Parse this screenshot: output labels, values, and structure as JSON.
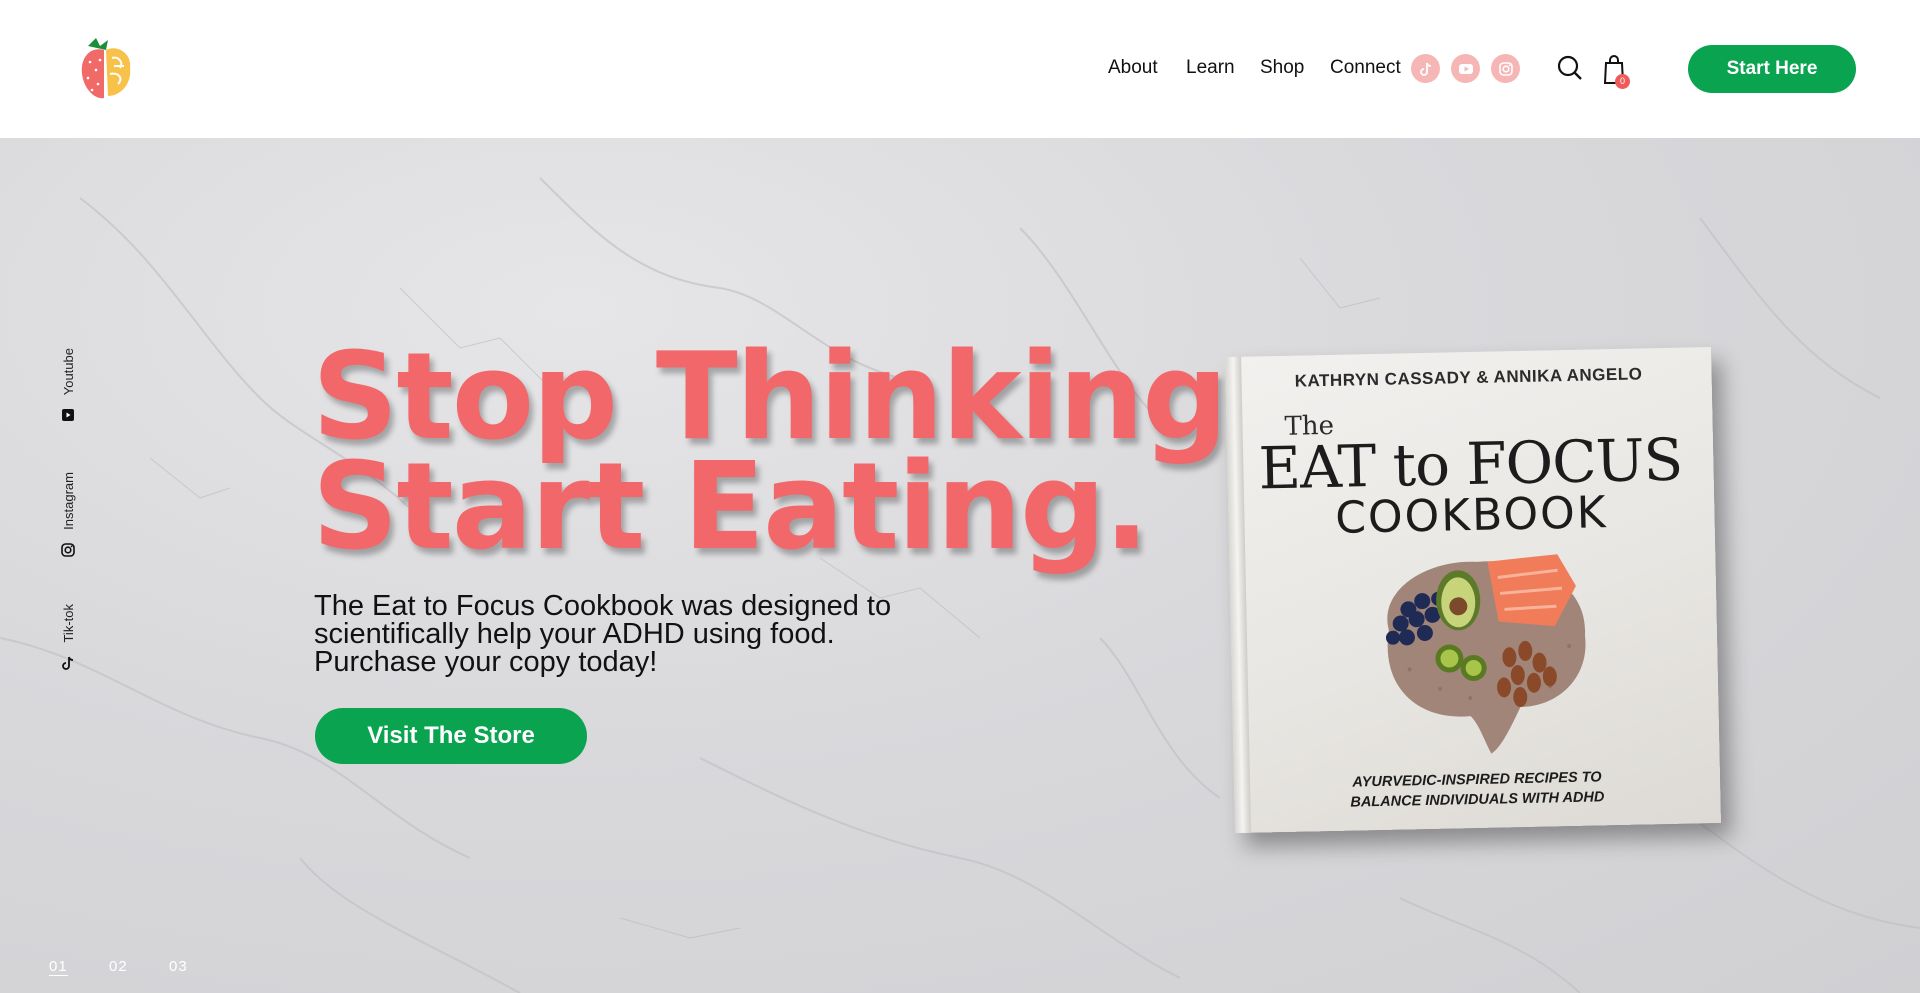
{
  "header": {
    "logo_name": "strawberry-brain-logo",
    "nav": [
      {
        "label": "About"
      },
      {
        "label": "Learn"
      },
      {
        "label": "Shop"
      },
      {
        "label": "Connect"
      }
    ],
    "social_icons": [
      "tiktok-icon",
      "youtube-icon",
      "instagram-icon"
    ],
    "cart_count": "0",
    "start_label": "Start Here"
  },
  "hero": {
    "headline_line1": "Stop Thinking.",
    "headline_line2": "Start Eating.",
    "subtext": "The Eat to Focus Cookbook was designed to scientifically help your ADHD using food. Purchase your copy today!",
    "button_label": "Visit The Store",
    "side_social": [
      {
        "label": "Youtube",
        "icon": "youtube-icon"
      },
      {
        "label": "Instagram",
        "icon": "instagram-icon"
      },
      {
        "label": "Tik-tok",
        "icon": "tiktok-icon"
      }
    ],
    "pager": [
      "01",
      "02",
      "03"
    ],
    "pager_active": "01"
  },
  "book": {
    "authors": "KATHRYN CASSADY & ANNIKA ANGELO",
    "the": "The",
    "title": "EAT to FOCUS",
    "subtitle": "COOKBOOK",
    "tagline_line1": "AYURVEDIC-INSPIRED RECIPES TO",
    "tagline_line2": "BALANCE INDIVIDUALS WITH ADHD"
  },
  "colors": {
    "accent_green": "#0aa350",
    "headline_coral": "#f2686a",
    "social_pink": "#f6b6b6"
  }
}
